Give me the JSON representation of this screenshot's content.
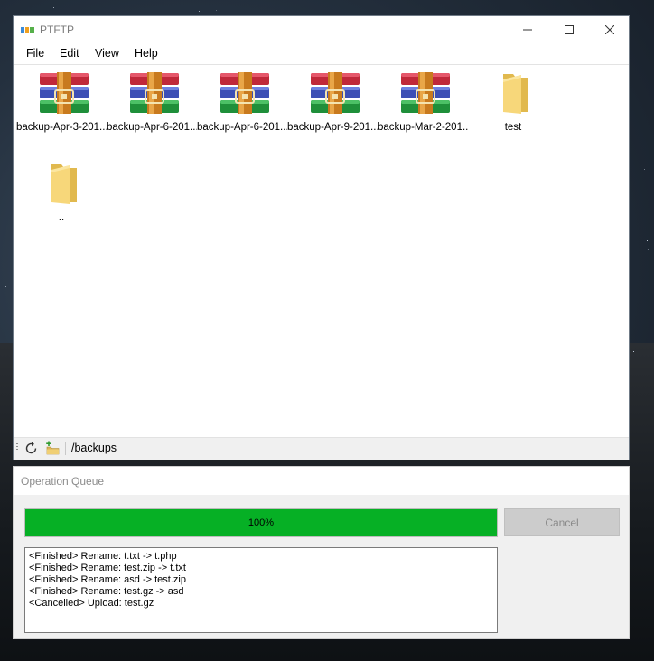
{
  "window": {
    "title": "PTFTP",
    "controls": {
      "minimize": "minimize-icon",
      "maximize": "maximize-icon",
      "close": "close-icon"
    }
  },
  "menu": [
    "File",
    "Edit",
    "View",
    "Help"
  ],
  "files": [
    {
      "name": "backup-Apr-3-201...",
      "type": "archive",
      "icon": "winrar-archive-icon"
    },
    {
      "name": "backup-Apr-6-201...",
      "type": "archive",
      "icon": "winrar-archive-icon"
    },
    {
      "name": "backup-Apr-6-201...",
      "type": "archive",
      "icon": "winrar-archive-icon"
    },
    {
      "name": "backup-Apr-9-201...",
      "type": "archive",
      "icon": "winrar-archive-icon"
    },
    {
      "name": "backup-Mar-2-201...",
      "type": "archive",
      "icon": "winrar-archive-icon"
    },
    {
      "name": "test",
      "type": "folder",
      "icon": "folder-icon"
    },
    {
      "name": "..",
      "type": "folder",
      "icon": "folder-icon"
    }
  ],
  "statusbar": {
    "path": "/backups",
    "refresh_icon": "refresh-icon",
    "new_folder_icon": "new-folder-icon"
  },
  "queue": {
    "title": "Operation Queue",
    "progress_label": "100%",
    "progress_fraction": 1.0,
    "progress_color": "#06b025",
    "cancel_label": "Cancel",
    "log": [
      "<Finished> Rename: t.txt -> t.php",
      "<Finished> Rename: test.zip -> t.txt",
      "<Finished> Rename: asd -> test.zip",
      "<Finished> Rename: test.gz -> asd",
      "<Cancelled> Upload: test.gz"
    ]
  }
}
